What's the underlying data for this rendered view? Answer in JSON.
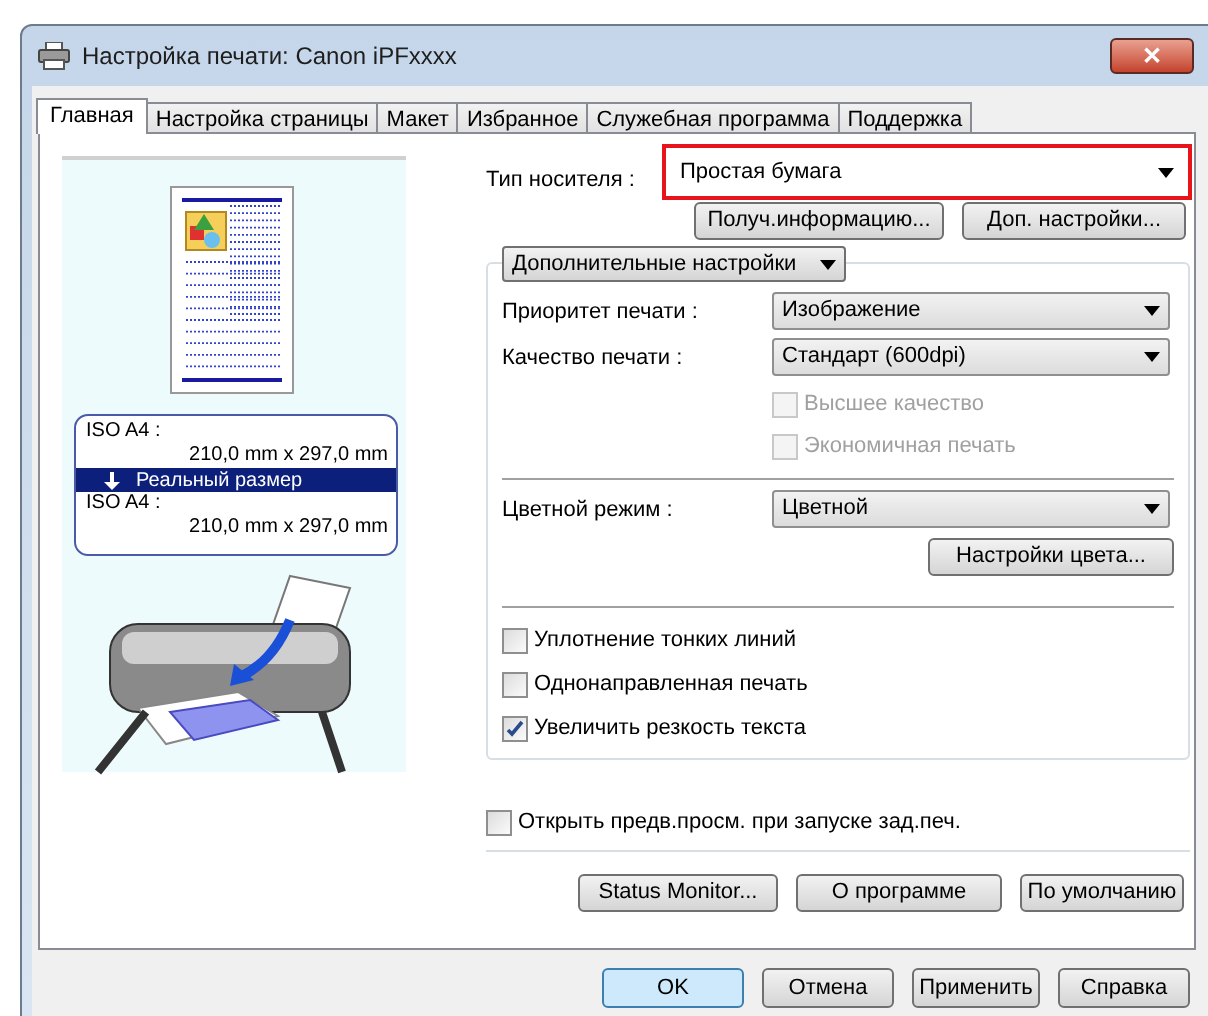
{
  "window": {
    "title": "Настройка печати: Canon iPFxxxx",
    "close": "✕"
  },
  "tabs": [
    {
      "label": "Главная",
      "selected": true
    },
    {
      "label": "Настройка страницы",
      "selected": false
    },
    {
      "label": "Макет",
      "selected": false
    },
    {
      "label": "Избранное",
      "selected": false
    },
    {
      "label": "Служебная программа",
      "selected": false
    },
    {
      "label": "Поддержка",
      "selected": false
    }
  ],
  "preview": {
    "page_size_label": "ISO A4 :",
    "page_size": "210,0 mm x 297,0 mm",
    "scaling": "Реальный размер",
    "output_size_label": "ISO A4 :",
    "output_size": "210,0 mm x 297,0 mm"
  },
  "media_type": {
    "label": "Тип носителя :",
    "value": "Простая бумага",
    "highlighted": true
  },
  "media_buttons": [
    "Получ.информацию...",
    "Доп. настройки..."
  ],
  "advanced": {
    "header": "Дополнительные настройки",
    "items": [
      {
        "kind": "dropdown",
        "label": "Приоритет печати :",
        "value": "Изображение"
      },
      {
        "kind": "dropdown",
        "label": "Качество печати :",
        "value": "Стандарт (600dpi)"
      },
      {
        "kind": "subcheck",
        "label": "Высшее качество",
        "checked": false,
        "disabled": true
      },
      {
        "kind": "subcheck",
        "label": "Экономичная печать",
        "checked": false,
        "disabled": true
      },
      {
        "kind": "divider"
      },
      {
        "kind": "dropdown",
        "label": "Цветной режим :",
        "value": "Цветной"
      },
      {
        "kind": "button",
        "label": "Настройки цвета..."
      },
      {
        "kind": "divider"
      },
      {
        "kind": "check",
        "label": "Уплотнение тонких линий",
        "checked": false,
        "disabled": false
      },
      {
        "kind": "check",
        "label": "Однонаправленная печать",
        "checked": false,
        "disabled": false
      },
      {
        "kind": "check",
        "label": "Увеличить резкость текста",
        "checked": true,
        "disabled": false
      }
    ]
  },
  "preview_on_start": {
    "label": "Открыть предв.просм. при запуске зад.печ.",
    "checked": false
  },
  "panel_buttons": [
    "Status Monitor...",
    "О программе",
    "По умолчанию"
  ],
  "dialog_buttons": [
    {
      "label": "OK",
      "default": true
    },
    {
      "label": "Отмена",
      "default": false
    },
    {
      "label": "Применить",
      "default": false
    },
    {
      "label": "Справка",
      "default": false
    }
  ]
}
